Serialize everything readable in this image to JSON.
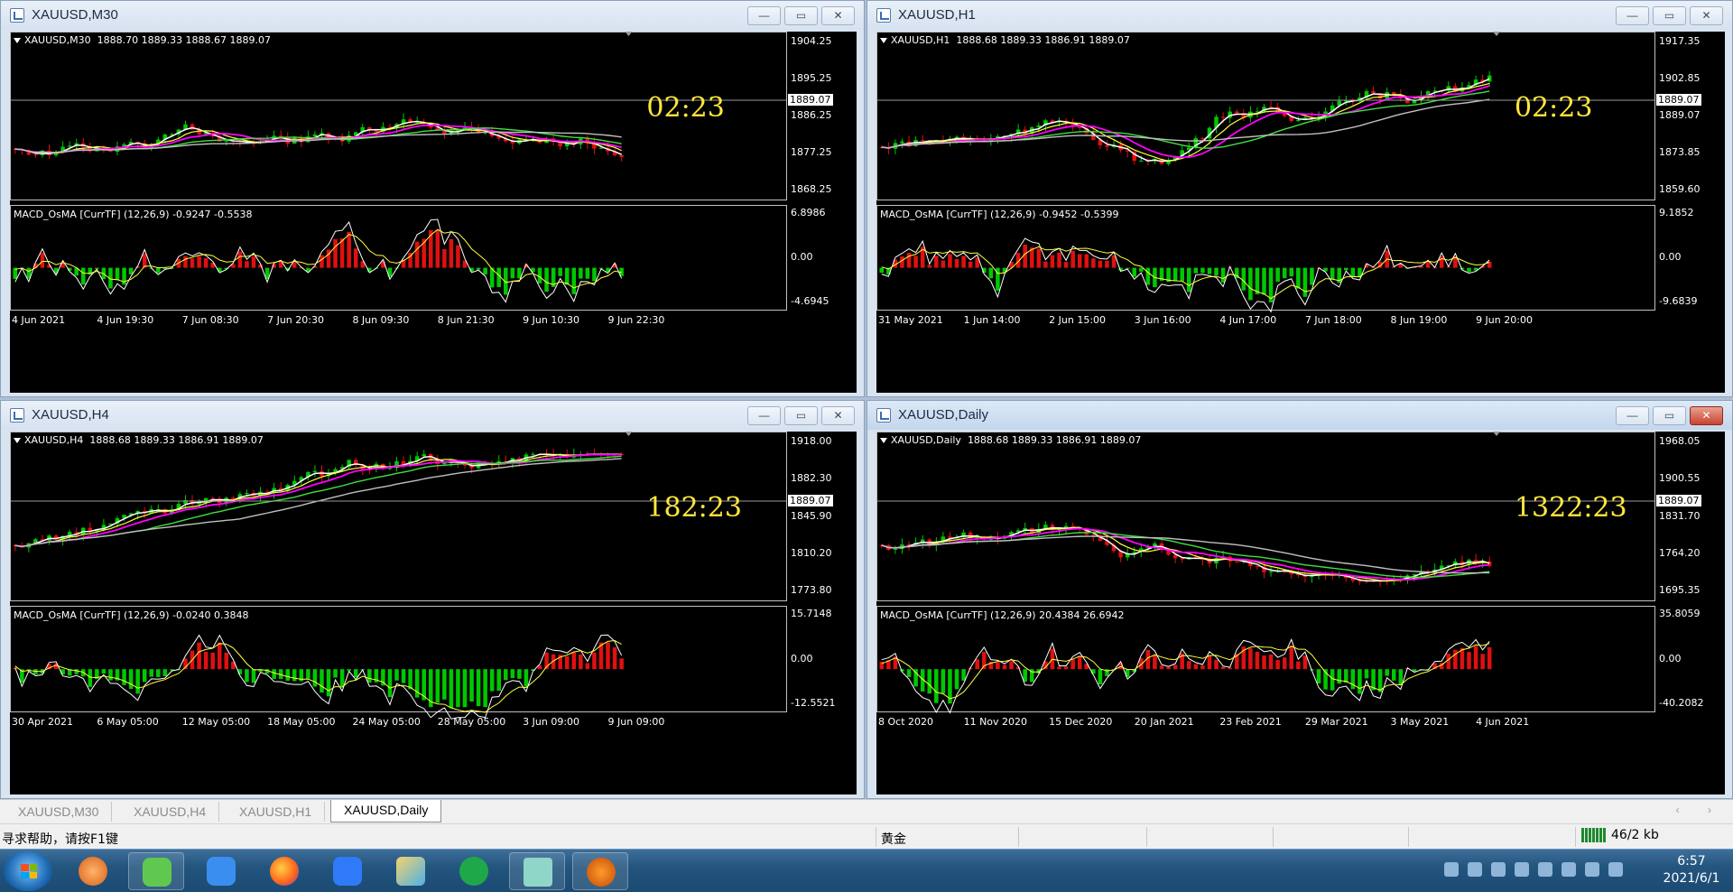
{
  "charts": [
    {
      "title": "XAUUSD,M30",
      "ohlc": "XAUUSD,M30  1888.70 1889.33 1888.67 1889.07",
      "countdown": "02:23",
      "price_levels": [
        "1904.25",
        "1895.25",
        "1886.25",
        "1877.25",
        "1868.25"
      ],
      "current_price": "1889.07",
      "macd_label": "MACD_OsMA [CurrTF] (12,26,9) -0.9247 -0.5538",
      "macd_levels": [
        "6.8986",
        "0.00",
        "-4.6945"
      ],
      "time_labels": [
        "4 Jun 2021",
        "4 Jun 19:30",
        "7 Jun 08:30",
        "7 Jun 20:30",
        "8 Jun 09:30",
        "8 Jun 21:30",
        "9 Jun 10:30",
        "9 Jun 22:30"
      ]
    },
    {
      "title": "XAUUSD,H1",
      "ohlc": "XAUUSD,H1  1888.68 1889.33 1886.91 1889.07",
      "countdown": "02:23",
      "price_levels": [
        "1917.35",
        "1902.85",
        "1889.07",
        "1873.85",
        "1859.60"
      ],
      "current_price": "1889.07",
      "macd_label": "MACD_OsMA [CurrTF] (12,26,9) -0.9452 -0.5399",
      "macd_levels": [
        "9.1852",
        "0.00",
        "-9.6839"
      ],
      "time_labels": [
        "31 May 2021",
        "1 Jun 14:00",
        "2 Jun 15:00",
        "3 Jun 16:00",
        "4 Jun 17:00",
        "7 Jun 18:00",
        "8 Jun 19:00",
        "9 Jun 20:00"
      ]
    },
    {
      "title": "XAUUSD,H4",
      "ohlc": "XAUUSD,H4  1888.68 1889.33 1886.91 1889.07",
      "countdown": "182:23",
      "price_levels": [
        "1918.00",
        "1882.30",
        "1845.90",
        "1810.20",
        "1773.80"
      ],
      "current_price": "1889.07",
      "macd_label": "MACD_OsMA [CurrTF] (12,26,9) -0.0240 0.3848",
      "macd_levels": [
        "15.7148",
        "0.00",
        "-12.5521"
      ],
      "time_labels": [
        "30 Apr 2021",
        "6 May 05:00",
        "12 May 05:00",
        "18 May 05:00",
        "24 May 05:00",
        "28 May 05:00",
        "3 Jun 09:00",
        "9 Jun 09:00"
      ]
    },
    {
      "title": "XAUUSD,Daily",
      "ohlc": "XAUUSD,Daily  1888.68 1889.33 1886.91 1889.07",
      "countdown": "1322:23",
      "price_levels": [
        "1968.05",
        "1900.55",
        "1831.70",
        "1764.20",
        "1695.35"
      ],
      "current_price": "1889.07",
      "macd_label": "MACD_OsMA [CurrTF] (12,26,9) 20.4384 26.6942",
      "macd_levels": [
        "35.8059",
        "0.00",
        "-40.2082"
      ],
      "time_labels": [
        "8 Oct 2020",
        "11 Nov 2020",
        "15 Dec 2020",
        "20 Jan 2021",
        "23 Feb 2021",
        "29 Mar 2021",
        "3 May 2021",
        "4 Jun 2021"
      ]
    }
  ],
  "window_controls": {
    "minimize": "—",
    "restore": "▭",
    "close": "✕"
  },
  "tabs": [
    "XAUUSD,M30",
    "XAUUSD,H4",
    "XAUUSD,H1",
    "XAUUSD,Daily"
  ],
  "active_tab": "XAUUSD,Daily",
  "status": {
    "help": "寻求帮助，请按F1键",
    "symbol": "黄金",
    "connection": "46/2 kb"
  },
  "taskbar": {
    "time": "6:57",
    "date": "2021/6/1"
  },
  "colors": {
    "bull": "#00c800",
    "bear": "#e01010",
    "ma_fast": "#ffffff",
    "ma_yellow": "#ffff40",
    "ma_magenta": "#ff00ff",
    "ma_green": "#40e040",
    "ma_gray": "#c0c0c0",
    "countdown": "#ffe83a"
  }
}
